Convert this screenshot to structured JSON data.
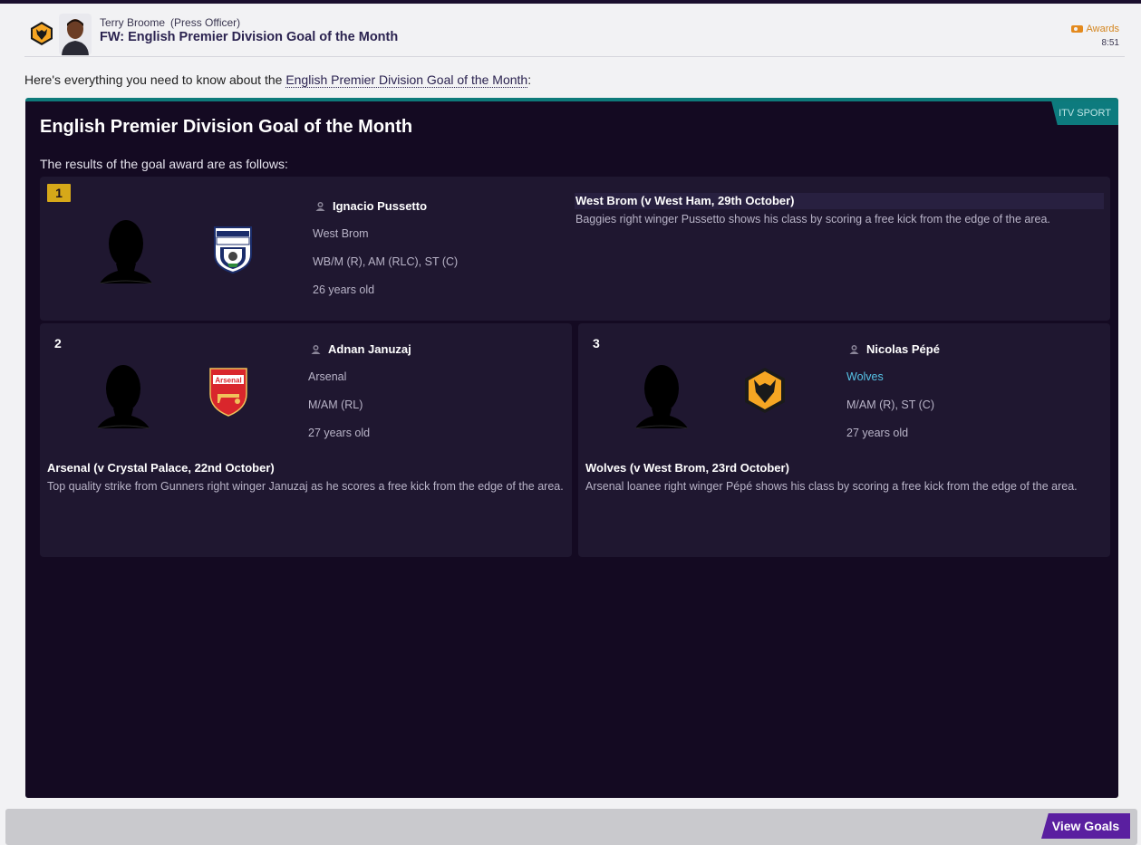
{
  "header": {
    "sender_name": "Terry Broome",
    "sender_role": "(Press Officer)",
    "subject": "FW: English Premier Division Goal of the Month",
    "category": "Awards",
    "time": "8:51",
    "club_badge_icon": "wolves-crest-icon"
  },
  "intro": {
    "prefix": "Here's everything you need to know about the ",
    "link": "English Premier Division Goal of the Month",
    "suffix": ":"
  },
  "panel": {
    "source": "ITV SPORT",
    "title": "English Premier Division Goal of the Month",
    "subtitle": "The results of the goal award are as follows:"
  },
  "results": [
    {
      "rank": "1",
      "player": "Ignacio Pussetto",
      "club": "West Brom",
      "positions": "WB/M (R), AM (RLC), ST (C)",
      "age": "26 years old",
      "club_icon": "west-brom-crest-icon",
      "match": "West Brom (v West Ham, 29th October)",
      "description": "Baggies right winger Pussetto shows his class by scoring a free kick from the edge of the area."
    },
    {
      "rank": "2",
      "player": "Adnan Januzaj",
      "club": "Arsenal",
      "positions": "M/AM (RL)",
      "age": "27 years old",
      "club_icon": "arsenal-crest-icon",
      "match": "Arsenal (v Crystal Palace, 22nd October)",
      "description": "Top quality strike from Gunners right winger Januzaj as he scores a free kick from the edge of the area."
    },
    {
      "rank": "3",
      "player": "Nicolas Pépé",
      "club": "Wolves",
      "positions": "M/AM (R), ST (C)",
      "age": "27 years old",
      "club_icon": "wolves-crest-icon",
      "match": "Wolves (v West Brom, 23rd October)",
      "description": "Arsenal loanee right winger Pépé shows his class by scoring a free kick from the edge of the area."
    }
  ],
  "footer": {
    "view_goals_label": "View Goals"
  },
  "colors": {
    "panel_bg": "#140a22",
    "card_bg": "#1f1730",
    "accent_teal": "#0d7b7e",
    "gold_rank": "#d6a819",
    "button_purple": "#5a1fa0",
    "link_blue": "#56c3e6"
  }
}
